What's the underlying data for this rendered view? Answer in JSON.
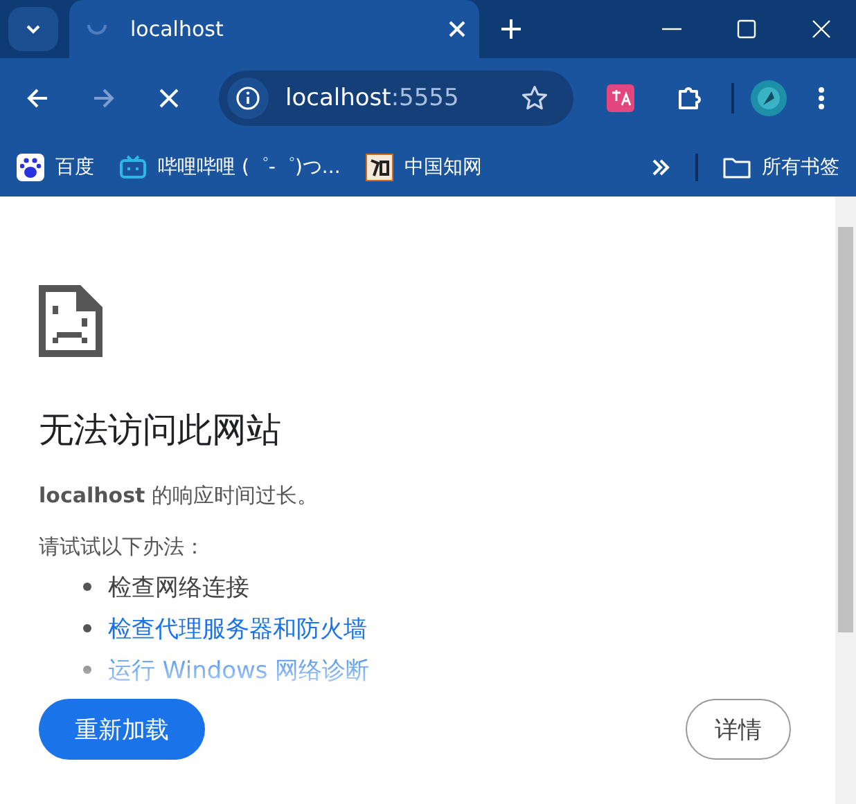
{
  "tab": {
    "title": "localhost",
    "loading": true
  },
  "address": {
    "host": "localhost",
    "port": ":5555"
  },
  "bookmarks": [
    {
      "label": "百度",
      "kind": "paw"
    },
    {
      "label": "哔哩哔哩 (゜-゜)つ...",
      "kind": "tv"
    },
    {
      "label": "中国知网",
      "kind": "tile"
    }
  ],
  "all_bookmarks": "所有书签",
  "error": {
    "title": "无法访问此网站",
    "message": "**localhost** 的响应时间过长。",
    "hint": "请试试以下办法：",
    "suggestions": [
      {
        "text": "检查网络连接",
        "kind": "text"
      },
      {
        "text": "检查代理服务器和防火墙",
        "kind": "link"
      },
      {
        "text": "运行 Windows 网络诊断",
        "kind": "link"
      }
    ]
  },
  "buttons": {
    "reload": "重新加载",
    "details": "详情"
  }
}
